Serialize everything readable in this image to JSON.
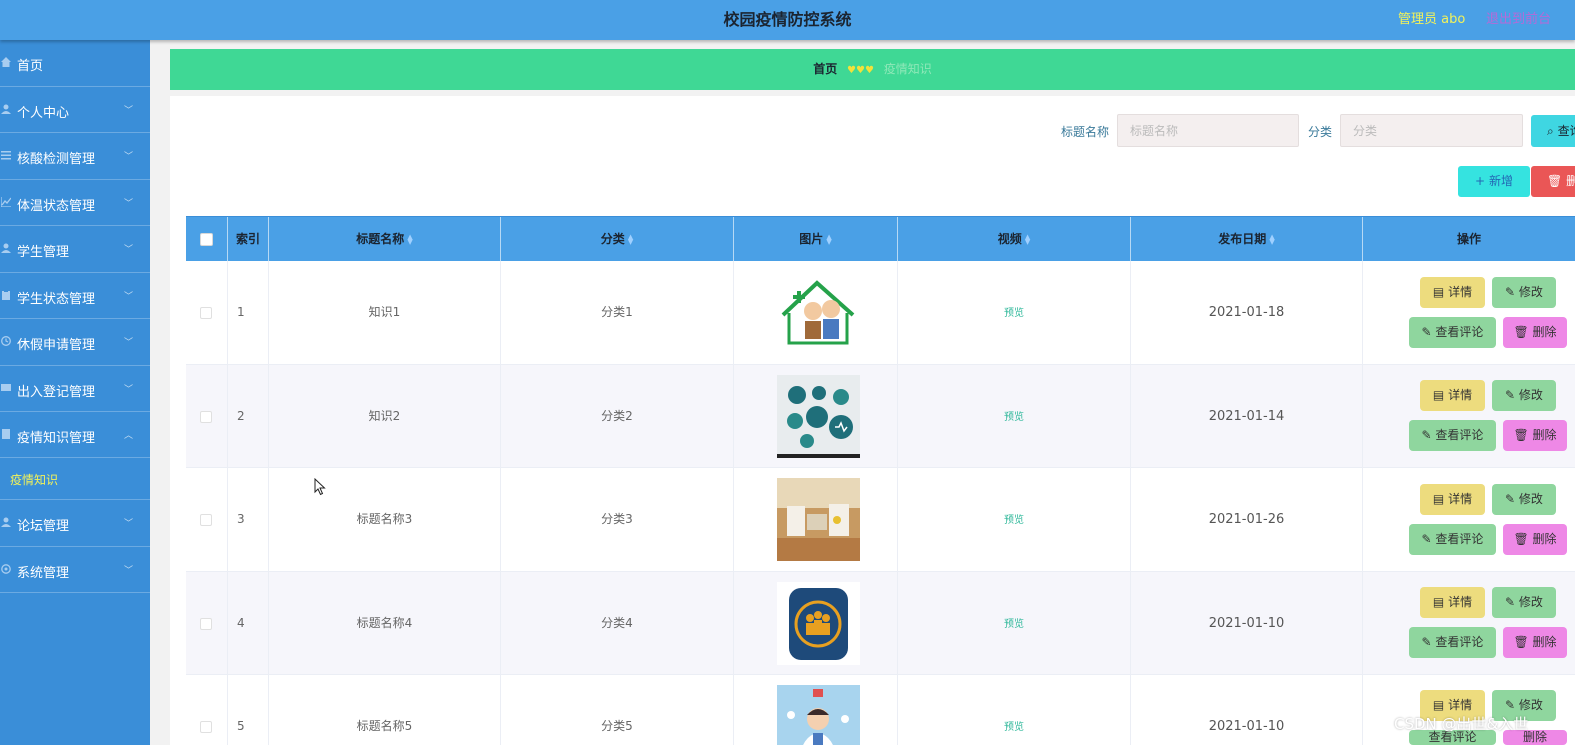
{
  "header": {
    "title": "校园疫情防控系统",
    "admin_label": "管理员 abo",
    "exit_label": "退出到前台"
  },
  "sidebar": {
    "items": [
      {
        "label": "首页",
        "icon": "home-icon",
        "has_chevron": false
      },
      {
        "label": "个人中心",
        "icon": "user-icon",
        "has_chevron": true
      },
      {
        "label": "核酸检测管理",
        "icon": "sliders-icon",
        "has_chevron": true
      },
      {
        "label": "体温状态管理",
        "icon": "chart-icon",
        "has_chevron": true
      },
      {
        "label": "学生管理",
        "icon": "student-icon",
        "has_chevron": true
      },
      {
        "label": "学生状态管理",
        "icon": "clipboard-icon",
        "has_chevron": true
      },
      {
        "label": "休假申请管理",
        "icon": "clock-icon",
        "has_chevron": true
      },
      {
        "label": "出入登记管理",
        "icon": "flag-icon",
        "has_chevron": true
      },
      {
        "label": "疫情知识管理",
        "icon": "book-icon",
        "has_chevron": true,
        "expanded": true
      }
    ],
    "submenu_label": "疫情知识",
    "items_after": [
      {
        "label": "论坛管理",
        "icon": "user-icon",
        "has_chevron": true
      },
      {
        "label": "系统管理",
        "icon": "gear-icon",
        "has_chevron": true
      }
    ]
  },
  "breadcrumb": {
    "home": "首页",
    "separator": "♥♥♥",
    "current": "疫情知识"
  },
  "search": {
    "title_label": "标题名称",
    "title_placeholder": "标题名称",
    "category_label": "分类",
    "category_placeholder": "分类",
    "search_button": "查询"
  },
  "actions": {
    "add_label": "新增",
    "delete_label": "删除"
  },
  "table": {
    "columns": [
      "索引",
      "标题名称",
      "分类",
      "图片",
      "视频",
      "发布日期",
      "操作"
    ],
    "rows": [
      {
        "index": "1",
        "title": "知识1",
        "category": "分类1",
        "image": "elderly-couple-house-image",
        "video": "预览",
        "date": "2021-01-18"
      },
      {
        "index": "2",
        "title": "知识2",
        "category": "分类2",
        "image": "medical-icons-image",
        "video": "预览",
        "date": "2021-01-14"
      },
      {
        "index": "3",
        "title": "标题名称3",
        "category": "分类3",
        "image": "hospital-ward-image",
        "video": "预览",
        "date": "2021-01-26"
      },
      {
        "index": "4",
        "title": "标题名称4",
        "category": "分类4",
        "image": "people-group-badge-image",
        "video": "预览",
        "date": "2021-01-10"
      },
      {
        "index": "5",
        "title": "标题名称5",
        "category": "分类5",
        "image": "doctor-illustration-image",
        "video": "预览",
        "date": "2021-01-10"
      }
    ],
    "row_buttons": {
      "detail": "详情",
      "edit": "修改",
      "comment": "查看评论",
      "delete": "删除"
    }
  },
  "watermark": "CSDN @出世&入世",
  "colors": {
    "header_bg": "#4aa0e6",
    "sidebar_bg": "#3a8ed8",
    "breadcrumb_bg": "#3fd895",
    "accent_yellow": "#f2f25a"
  }
}
